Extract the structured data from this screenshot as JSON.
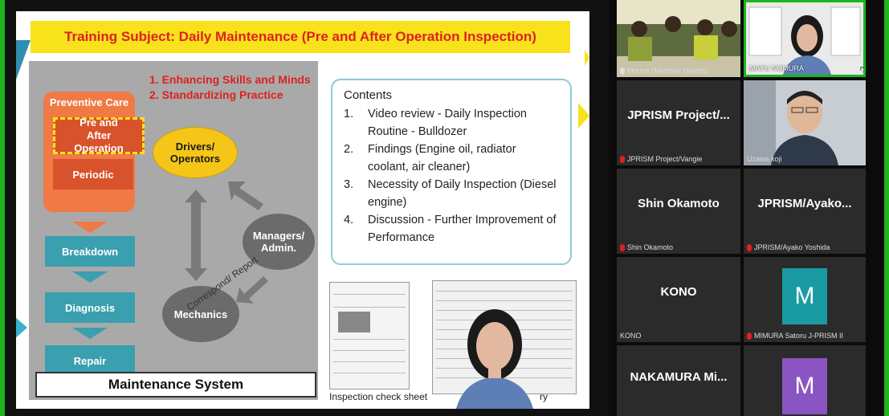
{
  "slide": {
    "title": "Training Subject: Daily Maintenance (Pre and After Operation Inspection)",
    "objectives": [
      "1. Enhancing Skills and Minds",
      "2. Standardizing Practice"
    ],
    "diagram": {
      "preventive_care": "Preventive Care",
      "pre_after": "Pre and After Operation",
      "periodic": "Periodic",
      "breakdown": "Breakdown",
      "diagnosis": "Diagnosis",
      "repair": "Repair",
      "drivers": "Drivers/ Operators",
      "managers": "Managers/ Admin.",
      "mechanics": "Mechanics",
      "correspond": "Correspond/ Report",
      "system_label": "Maintenance System"
    },
    "contents": {
      "title": "Contents",
      "items": [
        {
          "num": "1.",
          "text": "Video review - Daily Inspection Routine - Bulldozer"
        },
        {
          "num": "2.",
          "text": "Findings (Engine oil, radiator coolant, air cleaner)"
        },
        {
          "num": "3.",
          "text": "Necessity of Daily Inspection (Diesel engine)"
        },
        {
          "num": "4.",
          "text": "Discussion - Further Improvement of Performance"
        }
      ]
    },
    "sheet_caption": "Inspection check sheet",
    "sheet_caption_right": "ry"
  },
  "participants": [
    {
      "name": "",
      "label": "Morine (Marshall Islands)",
      "type": "video-group",
      "mic": "pin"
    },
    {
      "name": "",
      "label": "MAYU NOMURA",
      "label_suffix": "ry",
      "type": "video-person",
      "mic": "none"
    },
    {
      "name": "JPRISM Project/...",
      "label": "JPRISM Project/Vangie",
      "type": "name",
      "mic": "muted"
    },
    {
      "name": "",
      "label": "Uzawa koji",
      "type": "video-man",
      "mic": "none"
    },
    {
      "name": "Shin Okamoto",
      "label": "Shin Okamoto",
      "type": "name",
      "mic": "muted"
    },
    {
      "name": "JPRISM/Ayako...",
      "label": "JPRISM/Ayako Yoshida",
      "type": "name",
      "mic": "muted"
    },
    {
      "name": "KONO",
      "label": "KONO",
      "type": "name",
      "mic": "none"
    },
    {
      "name": "M",
      "label": "MIMURA Satoru J-PRISM II",
      "type": "avatar",
      "color": "#1a9aa3",
      "mic": "muted"
    },
    {
      "name": "NAKAMURA Mi...",
      "label": "",
      "type": "name",
      "mic": "none"
    },
    {
      "name": "M",
      "label": "",
      "type": "avatar",
      "color": "#8a55c2",
      "mic": "none"
    }
  ],
  "colors": {
    "banner": "#f7e21b",
    "title_red": "#e02020",
    "orange": "#f07a45",
    "teal": "#3a9fae",
    "speaker_border": "#1db41d"
  }
}
